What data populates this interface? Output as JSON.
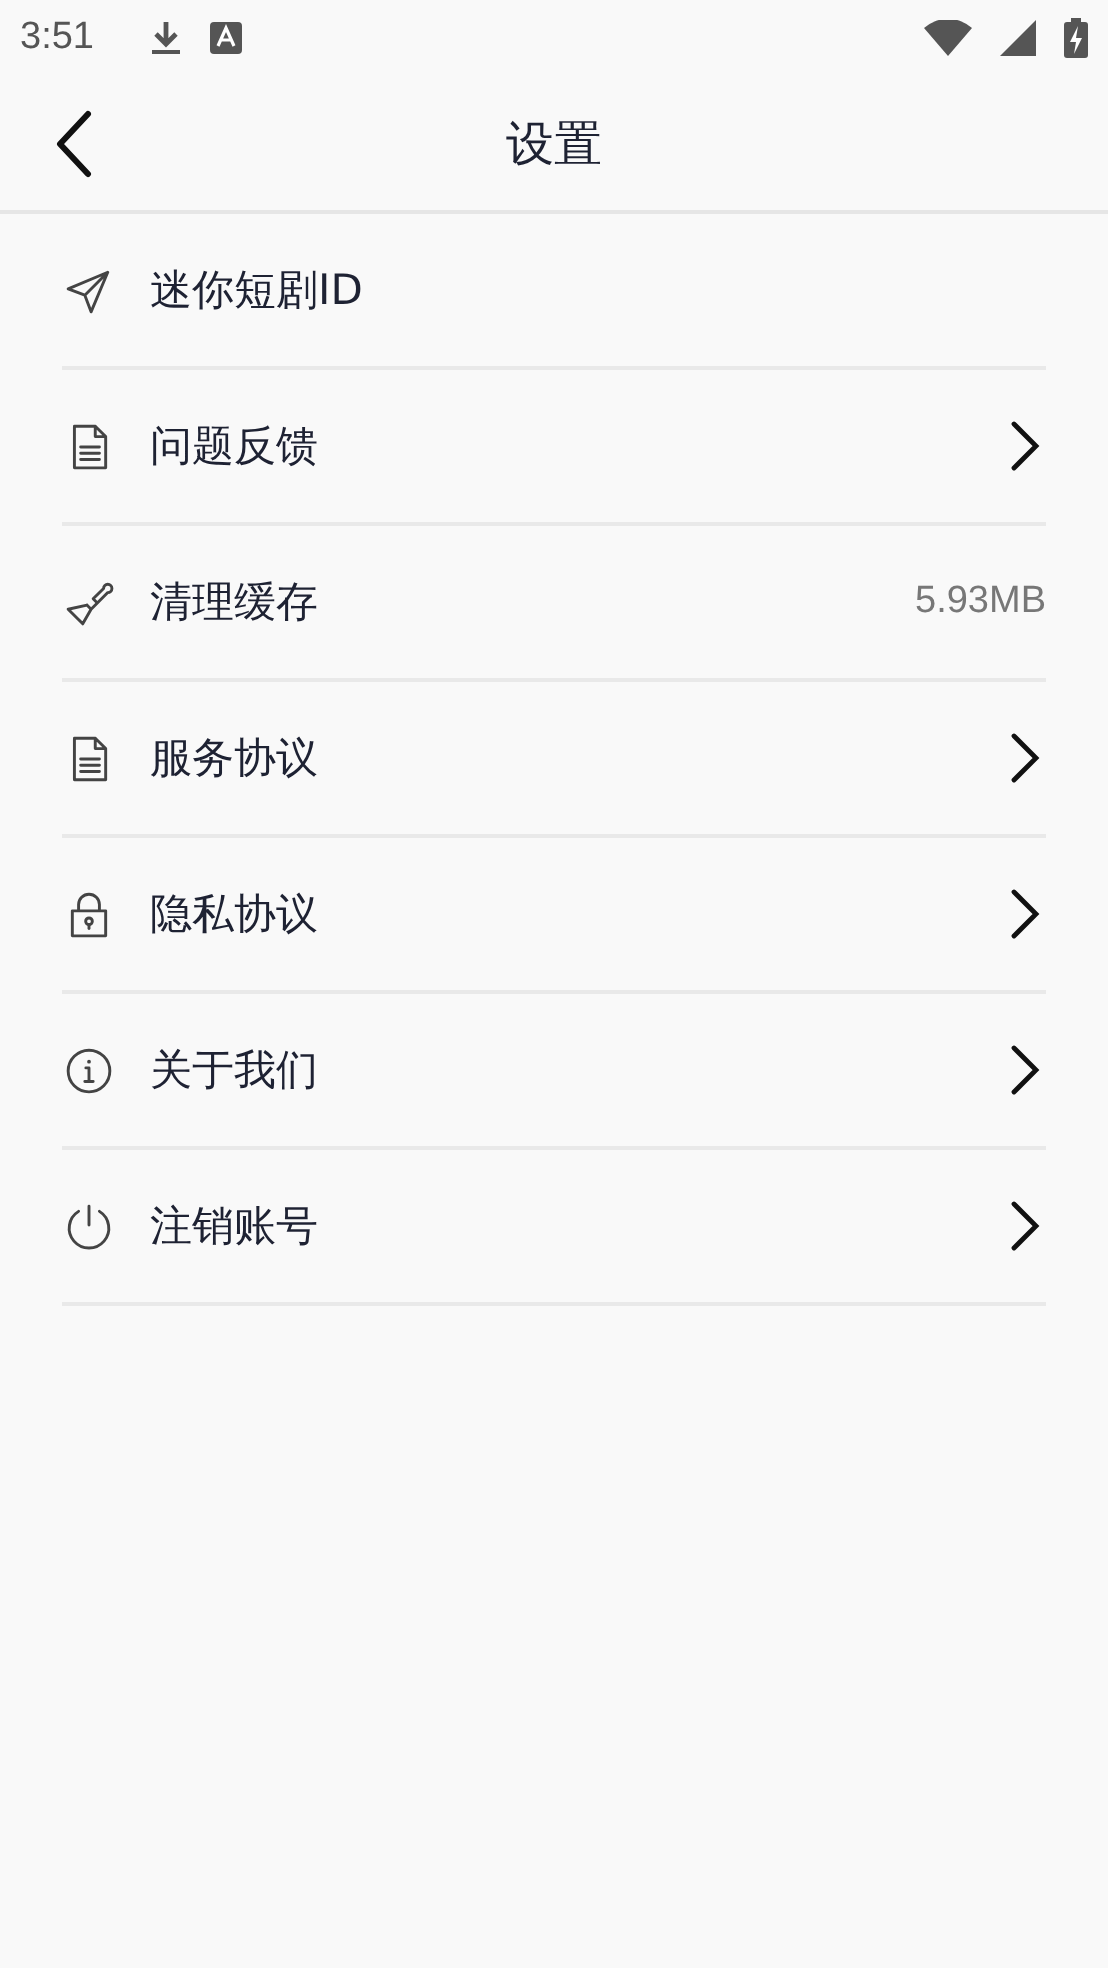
{
  "status_bar": {
    "time": "3:51",
    "notifications": [
      {
        "kind": "download"
      },
      {
        "kind": "text-app"
      }
    ],
    "indicators": [
      {
        "kind": "wifi"
      },
      {
        "kind": "signal"
      },
      {
        "kind": "battery-charging"
      }
    ]
  },
  "header": {
    "title": "设置"
  },
  "items": [
    {
      "kind": "send",
      "label": "迷你短剧ID"
    },
    {
      "kind": "document",
      "label": "问题反馈",
      "trailing": {
        "kind": "chevron"
      }
    },
    {
      "kind": "brush",
      "label": "清理缓存",
      "trailing": {
        "kind": "value",
        "text": "5.93MB"
      }
    },
    {
      "kind": "document",
      "label": "服务协议",
      "trailing": {
        "kind": "chevron"
      }
    },
    {
      "kind": "lock",
      "label": "隐私协议",
      "trailing": {
        "kind": "chevron"
      }
    },
    {
      "kind": "info",
      "label": "关于我们",
      "trailing": {
        "kind": "chevron"
      }
    },
    {
      "kind": "power",
      "label": "注销账号",
      "trailing": {
        "kind": "chevron"
      }
    }
  ]
}
